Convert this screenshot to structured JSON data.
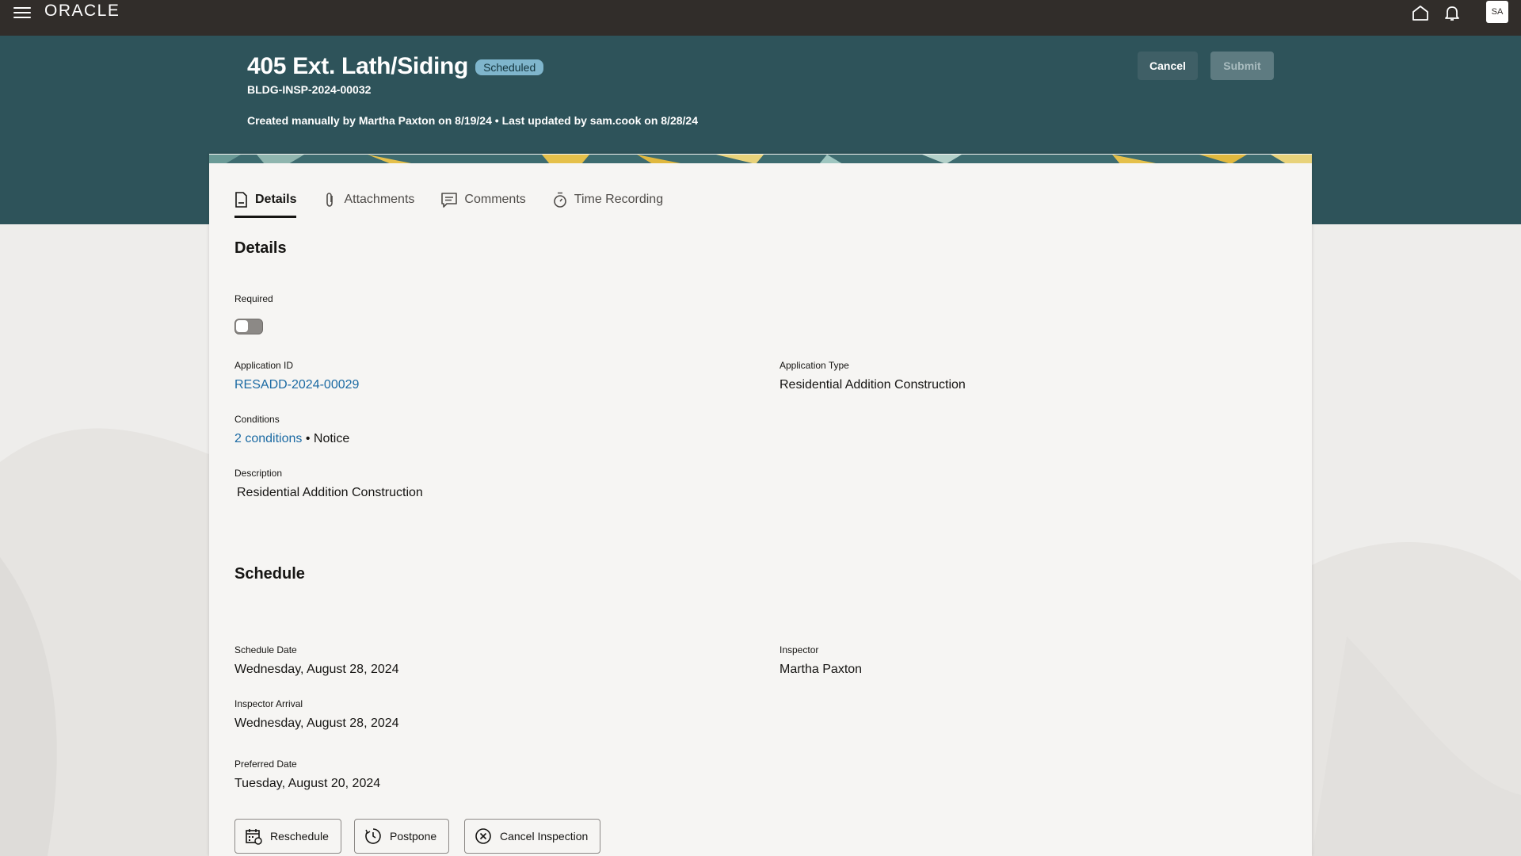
{
  "topbar": {
    "logo": "ORACLE",
    "avatar_initials": "SA",
    "icons": [
      "hamburger-menu-icon",
      "home-icon",
      "bell-icon"
    ]
  },
  "header": {
    "title": "405 Ext. Lath/Siding",
    "status": "Scheduled",
    "record_id": "BLDG-INSP-2024-00032",
    "audit": "Created manually by Martha Paxton on 8/19/24 • Last updated by sam.cook on 8/28/24",
    "cancel_label": "Cancel",
    "submit_label": "Submit"
  },
  "tabs": [
    {
      "label": "Details",
      "icon": "document-icon",
      "active": true
    },
    {
      "label": "Attachments",
      "icon": "paperclip-icon",
      "active": false
    },
    {
      "label": "Comments",
      "icon": "comment-icon",
      "active": false
    },
    {
      "label": "Time Recording",
      "icon": "stopwatch-icon",
      "active": false
    }
  ],
  "details": {
    "section_title": "Details",
    "required_label": "Required",
    "required_on": false,
    "application_id_label": "Application ID",
    "application_id": "RESADD-2024-00029",
    "application_type_label": "Application Type",
    "application_type": "Residential Addition Construction",
    "conditions_label": "Conditions",
    "conditions_link": "2 conditions",
    "conditions_separator": "•",
    "conditions_severity": "Notice",
    "description_label": "Description",
    "description": "Residential Addition Construction"
  },
  "schedule": {
    "section_title": "Schedule",
    "schedule_date_label": "Schedule Date",
    "schedule_date": "Wednesday, August 28, 2024",
    "inspector_label": "Inspector",
    "inspector": "Martha Paxton",
    "inspector_arrival_label": "Inspector Arrival",
    "inspector_arrival": "Wednesday, August 28, 2024",
    "preferred_date_label": "Preferred Date",
    "preferred_date": "Tuesday, August 20, 2024",
    "buttons": [
      {
        "label": "Reschedule",
        "icon": "calendar-icon"
      },
      {
        "label": "Postpone",
        "icon": "clock-icon"
      },
      {
        "label": "Cancel Inspection",
        "icon": "circle-x-icon"
      }
    ]
  },
  "colors": {
    "topbar": "#312d2a",
    "header_band": "#2e535a",
    "status_badge": "#7fb5cc",
    "link": "#1b6aa3",
    "card": "#f6f5f3"
  }
}
